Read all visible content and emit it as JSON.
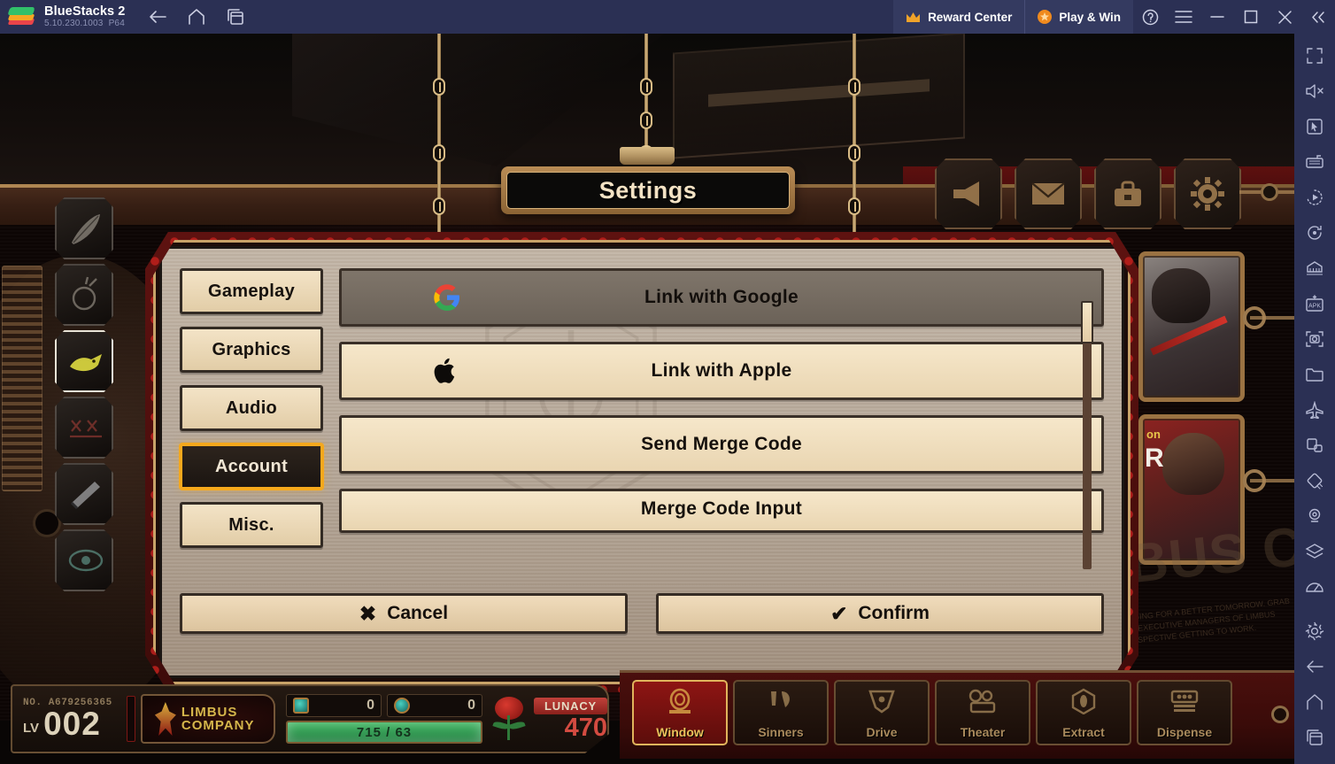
{
  "bluestacks": {
    "app_title": "BlueStacks 2",
    "version": "5.10.230.1003",
    "build_tag": "P64",
    "nav": [
      {
        "name": "back",
        "icon": "back-arrow-icon"
      },
      {
        "name": "home",
        "icon": "home-icon"
      },
      {
        "name": "recents",
        "icon": "multi-window-icon"
      }
    ],
    "reward_center_label": "Reward Center",
    "play_and_win_label": "Play & Win",
    "window_controls": [
      {
        "name": "help",
        "icon": "question-circle-icon"
      },
      {
        "name": "menu",
        "icon": "hamburger-icon"
      },
      {
        "name": "minimize",
        "icon": "minimize-icon"
      },
      {
        "name": "maximize",
        "icon": "maximize-icon"
      },
      {
        "name": "close",
        "icon": "close-icon"
      },
      {
        "name": "collapse-sidebar",
        "icon": "double-chevron-left-icon"
      }
    ],
    "sidebar_tools": [
      "fullscreen-icon",
      "mute-volume-icon",
      "cursor-pointer-icon",
      "keyboard-controls-icon",
      "macro-record-icon",
      "rotate-icon",
      "multi-instance-icon",
      "install-apk-icon",
      "screenshot-icon",
      "media-folder-icon",
      "airplane-eco-mode-icon",
      "pip-icon",
      "shake-icon",
      "location-icon",
      "layers-icon",
      "performance-meter-icon",
      "settings-gear-icon",
      "back-arrow-icon",
      "home-icon",
      "recents-icon"
    ]
  },
  "game": {
    "title_plate": "Settings",
    "top_right_icons": [
      {
        "name": "announcements",
        "icon": "megaphone-icon"
      },
      {
        "name": "mail",
        "icon": "envelope-icon"
      },
      {
        "name": "inventory",
        "icon": "briefcase-icon"
      },
      {
        "name": "game-settings",
        "icon": "gear-icon"
      }
    ],
    "left_shortcut_count": 6,
    "left_shortcut_highlight_index": 2,
    "banner_tag": "on",
    "banner_tag2": "R",
    "bg_watermark": "LIMBUS COMPANY",
    "bg_watermark_sub": "THE WEARY ARE BEGGING FOR A BETTER TOMORROW. GRAB THE GOLDEN BOUGH. EXECUTIVE MANAGERS OF LIMBUS COMPANY — THE PERSPECTIVE GETTING TO WORK.",
    "settings": {
      "nav_items": [
        {
          "label": "Gameplay",
          "active": false
        },
        {
          "label": "Graphics",
          "active": false
        },
        {
          "label": "Audio",
          "active": false
        },
        {
          "label": "Account",
          "active": true
        },
        {
          "label": "Misc.",
          "active": false
        }
      ],
      "options": [
        {
          "label": "Link with Google",
          "icon": "google-g-icon",
          "state": "disabled"
        },
        {
          "label": "Link with Apple",
          "icon": "apple-logo-icon",
          "state": "normal"
        },
        {
          "label": "Send Merge Code",
          "icon": "",
          "state": "normal"
        },
        {
          "label": "Merge Code Input",
          "icon": "",
          "state": "normal"
        }
      ],
      "cancel_label": "Cancel",
      "cancel_mark": "✖",
      "confirm_label": "Confirm",
      "confirm_mark": "✔",
      "accent_color": "#f5a81c",
      "panel_color": "#b7a99a",
      "frame_color": "#c8a268"
    },
    "hud": {
      "account_no": "NO. A679256365",
      "level_label": "LV",
      "level_value": "002",
      "logo_line1": "LIMBUS",
      "logo_line2": "COMPANY",
      "resource_1_value": "0",
      "resource_2_value": "0",
      "xp_text": "715 / 63",
      "lunacy_label": "LUNACY",
      "lunacy_value": "470"
    },
    "bottom_nav": [
      {
        "label": "Window",
        "icon": "window-icon",
        "active": true
      },
      {
        "label": "Sinners",
        "icon": "sinners-icon",
        "active": false
      },
      {
        "label": "Drive",
        "icon": "drive-icon",
        "active": false
      },
      {
        "label": "Theater",
        "icon": "theater-icon",
        "active": false
      },
      {
        "label": "Extract",
        "icon": "extract-icon",
        "active": false
      },
      {
        "label": "Dispense",
        "icon": "dispense-icon",
        "active": false
      }
    ]
  }
}
